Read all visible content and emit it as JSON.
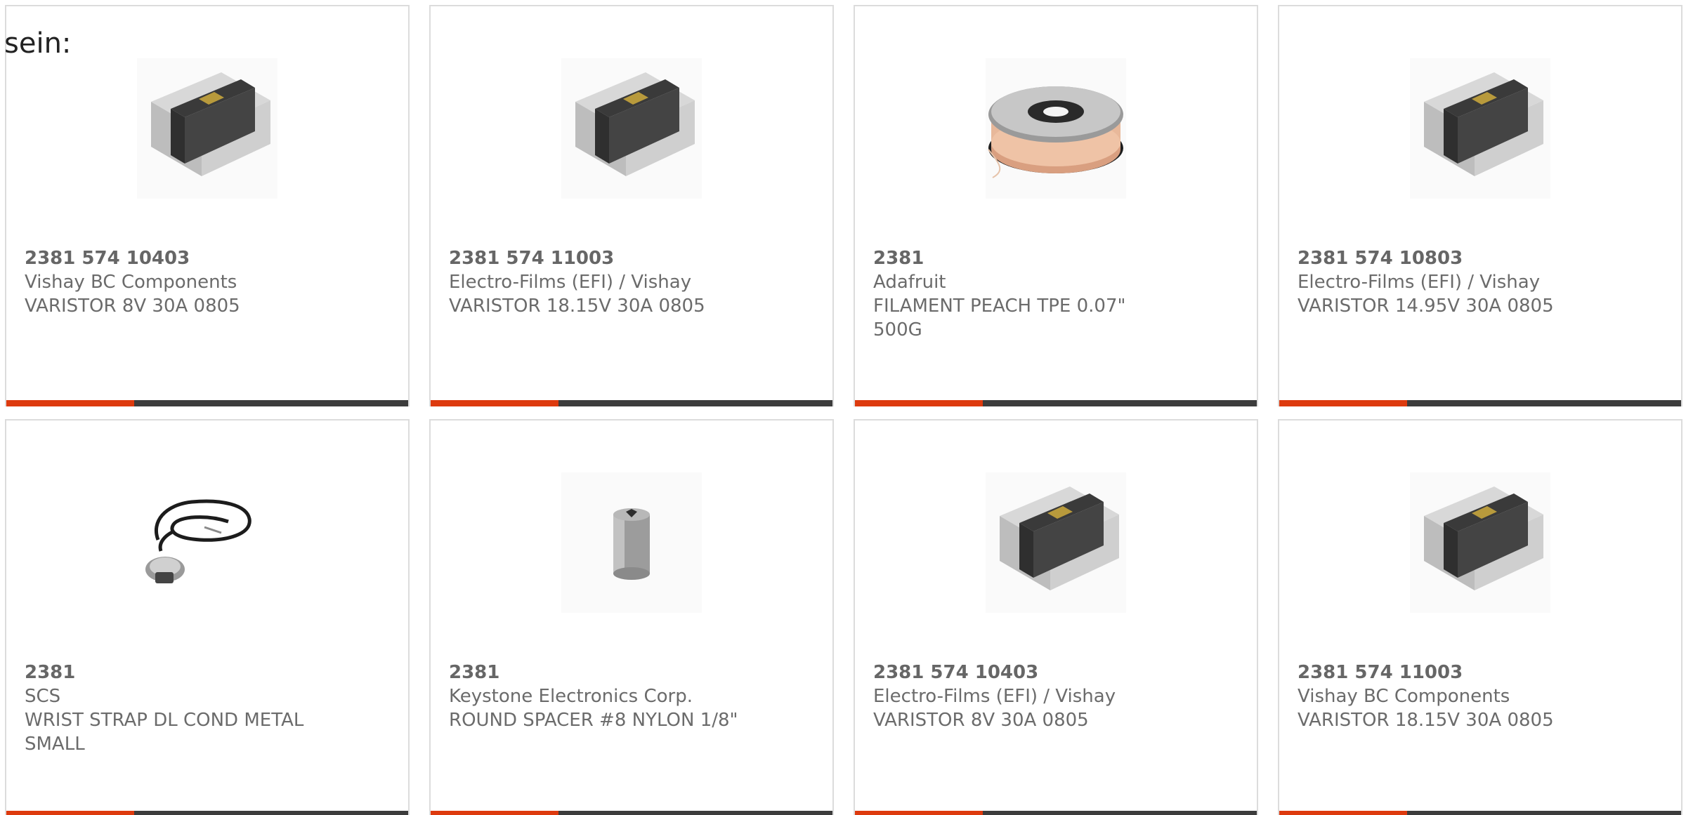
{
  "intro_text": "sein:",
  "colors": {
    "accent": "#dd3a0e",
    "bar": "#3c3c3c",
    "text": "#6b6b6b",
    "border": "#dcdcdc"
  },
  "products": [
    {
      "part_number": "2381 574 10403",
      "manufacturer": "Vishay BC Components",
      "description": "VARISTOR 8V 30A 0805",
      "image": "smd-varistor-chip"
    },
    {
      "part_number": "2381 574 11003",
      "manufacturer": "Electro-Films (EFI) / Vishay",
      "description": "VARISTOR 18.15V 30A 0805",
      "image": "smd-varistor-chip"
    },
    {
      "part_number": "2381",
      "manufacturer": "Adafruit",
      "description": "FILAMENT PEACH TPE 0.07\" 500G",
      "image": "filament-spool"
    },
    {
      "part_number": "2381 574 10803",
      "manufacturer": "Electro-Films (EFI) / Vishay",
      "description": "VARISTOR 14.95V 30A 0805",
      "image": "smd-varistor-chip"
    },
    {
      "part_number": "2381",
      "manufacturer": "SCS",
      "description": "WRIST STRAP DL COND METAL SMALL",
      "image": "wrist-strap"
    },
    {
      "part_number": "2381",
      "manufacturer": "Keystone Electronics Corp.",
      "description": "ROUND SPACER #8 NYLON 1/8\"",
      "image": "round-spacer"
    },
    {
      "part_number": "2381 574 10403",
      "manufacturer": "Electro-Films (EFI) / Vishay",
      "description": "VARISTOR 8V 30A 0805",
      "image": "smd-varistor-chip"
    },
    {
      "part_number": "2381 574 11003",
      "manufacturer": "Vishay BC Components",
      "description": "VARISTOR 18.15V 30A 0805",
      "image": "smd-varistor-chip"
    }
  ]
}
